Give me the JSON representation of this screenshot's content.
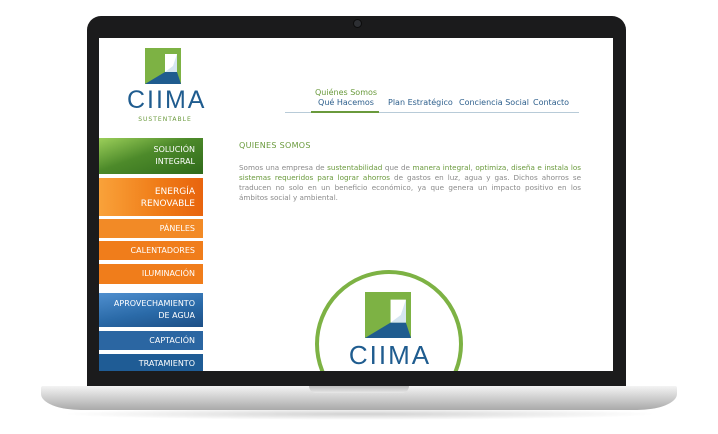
{
  "brand": {
    "name": "CIIMA",
    "tagline": "SUSTENTABLE"
  },
  "nav": {
    "items": [
      {
        "label_line1": "Quiénes Somos",
        "label_line2": "Qué Hacemos"
      },
      {
        "label": "Plan Estratégico"
      },
      {
        "label": "Conciencia Social"
      },
      {
        "label": "Contacto"
      }
    ]
  },
  "sidebar": {
    "items": [
      {
        "line1": "SOLUCIÓN",
        "line2": "INTEGRAL"
      },
      {
        "line1": "ENERGÍA",
        "line2": "RENOVABLE"
      },
      {
        "line1": "PÁNELES"
      },
      {
        "line1": "CALENTADORES"
      },
      {
        "line1": "ILUMINACIÓN"
      },
      {
        "line1": "APROVECHAMIENTO",
        "line2": "DE AGUA"
      },
      {
        "line1": "CAPTACIÓN"
      },
      {
        "line1": "TRATAMIENTO"
      }
    ]
  },
  "content": {
    "heading": "QUIENES SOMOS",
    "p1": "Somos una empresa de ",
    "p2": "sustentabilidad",
    "p3": " que de ",
    "p4": "manera integral",
    "p5": ", ",
    "p6": "optimiza",
    "p7": ",  ",
    "p8": "diseña e instala los sistemas requeridos para lograr ahorros",
    "p9": " de gastos en luz, agua y gas. Dichos ahorros se traducen no solo en un beneficio económico, ya que genera un impacto positivo en los ámbitos social y ambiental."
  },
  "colors": {
    "green": "#6a9a3c",
    "blue": "#1f5c8f",
    "orange": "#f07d1b"
  }
}
